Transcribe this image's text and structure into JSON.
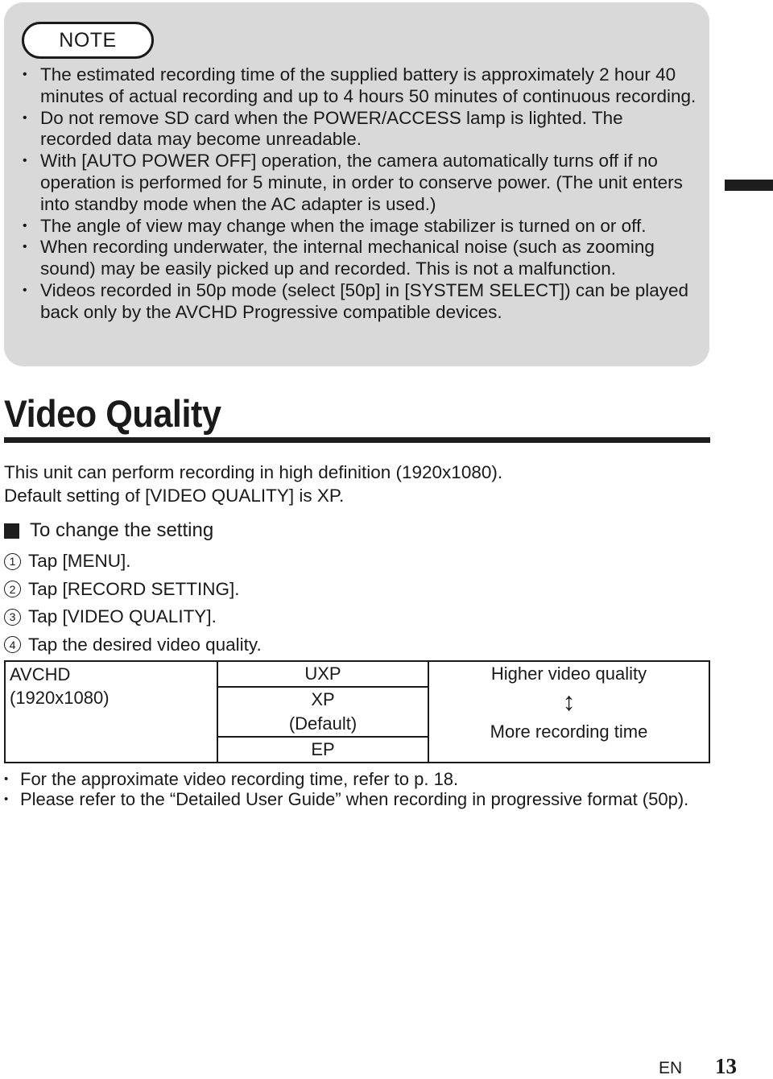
{
  "note": {
    "label": "NOTE",
    "items": [
      "The estimated recording time of the supplied battery is approximately 2 hour 40 minutes of actual recording and up to 4 hours 50 minutes of continuous recording.",
      "Do not remove SD card when the POWER/ACCESS lamp is lighted. The recorded data may become unreadable.",
      "With [AUTO POWER OFF] operation, the camera automatically turns off if no operation is performed for 5 minute, in order to conserve power. (The unit enters into standby mode when the AC adapter is used.)",
      "The angle of view may change when the image stabilizer is turned on or off.",
      "When recording underwater, the internal mechanical noise (such as zooming sound) may be easily picked up and recorded. This is not a malfunction.",
      "Videos recorded in 50p mode (select [50p] in [SYSTEM SELECT]) can be played back only by the AVCHD Progressive compatible devices."
    ]
  },
  "section": {
    "title": "Video Quality",
    "intro": [
      "This unit can perform recording in high definition (1920x1080).",
      "Default setting of [VIDEO QUALITY] is XP."
    ],
    "subheading": "To change the setting",
    "steps": [
      {
        "num": "1",
        "text": "Tap [MENU]."
      },
      {
        "num": "2",
        "text": "Tap [RECORD SETTING]."
      },
      {
        "num": "3",
        "text": "Tap [VIDEO QUALITY]."
      },
      {
        "num": "4",
        "text": "Tap the desired video quality."
      }
    ]
  },
  "quality_table": {
    "format": "AVCHD",
    "resolution": "(1920x1080)",
    "modes": [
      {
        "name": "UXP",
        "note": ""
      },
      {
        "name": "XP",
        "note": "(Default)"
      },
      {
        "name": "EP",
        "note": ""
      }
    ],
    "top_label": "Higher video quality",
    "bottom_label": "More recording time",
    "arrow": "↕"
  },
  "footnotes": [
    "For the approximate video recording time, refer to p. 18.",
    "Please refer to the “Detailed User Guide” when recording in progressive format (50p)."
  ],
  "footer": {
    "language": "EN",
    "page": "13"
  }
}
